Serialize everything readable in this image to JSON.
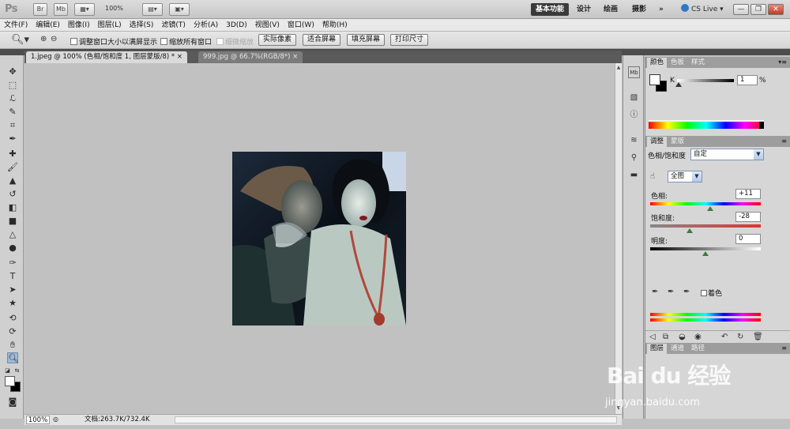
{
  "appbar": {
    "logo": "Ps",
    "bridge_btn": "Br",
    "minibridge_btn": "Mb",
    "zoom_level": "100%",
    "workspaces": [
      "基本功能",
      "设计",
      "绘画",
      "摄影"
    ],
    "more": "»",
    "cs_live": "CS Live",
    "window_controls": [
      "—",
      "❐",
      "✕"
    ]
  },
  "menu": [
    "文件(F)",
    "编辑(E)",
    "图像(I)",
    "图层(L)",
    "选择(S)",
    "滤镜(T)",
    "分析(A)",
    "3D(D)",
    "视图(V)",
    "窗口(W)",
    "帮助(H)"
  ],
  "options": {
    "resize_windows": "调整窗口大小以满屏显示",
    "zoom_all": "缩放所有窗口",
    "scrubby_zoom": "细微缩放",
    "actual_pixels": "实际像素",
    "fit_screen": "适合屏幕",
    "fill_screen": "填充屏幕",
    "print_size": "打印尺寸"
  },
  "tabs": [
    {
      "label": "1.jpeg @ 100% (色相/饱和度 1, 图层蒙版/8) *",
      "close": "×"
    },
    {
      "label": "999.jpg @ 66.7%(RGB/8*)",
      "close": "×"
    }
  ],
  "status": {
    "zoom": "100%",
    "doc": "文档:263.7K/732.4K"
  },
  "color_panel": {
    "tabs": [
      "颜色",
      "色板",
      "样式"
    ],
    "channel": "K",
    "value": "1",
    "unit": "%"
  },
  "adjust_panel": {
    "tabs": [
      "调整",
      "蒙版"
    ],
    "title": "色相/饱和度",
    "preset": "自定",
    "range": "全图",
    "hue_label": "色相:",
    "hue_value": "+11",
    "hue_level": 0.54,
    "sat_label": "饱和度:",
    "sat_value": "-28",
    "sat_level": 0.36,
    "light_label": "明度:",
    "light_value": "0",
    "light_level": 0.5,
    "colorize": "着色"
  },
  "layers_panel": {
    "tabs": [
      "图层",
      "通道",
      "路径"
    ]
  },
  "watermark": {
    "logo": "Bai du 经验",
    "url": "jingyan.baidu.com"
  }
}
